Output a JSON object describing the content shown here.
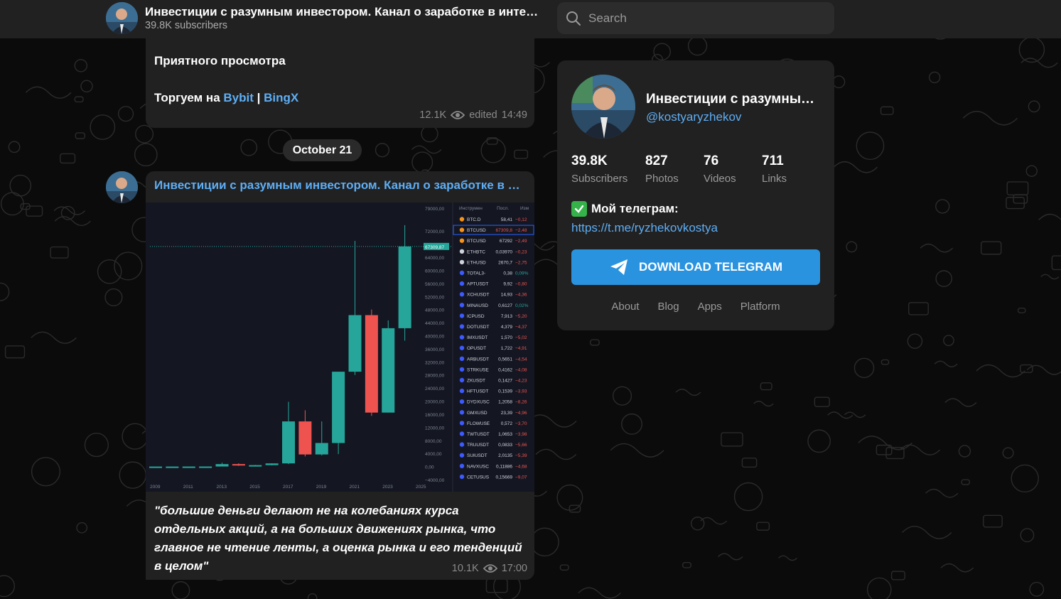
{
  "header": {
    "channel_title": "Инвестиции с разумным инвестором. Канал о заработке в интер…",
    "subscribers": "39.8K subscribers",
    "search_placeholder": "Search"
  },
  "messages": [
    {
      "line1": "Приятного просмотра",
      "line2_prefix": "Торгуем на ",
      "link1": "Bybit",
      "separator": " | ",
      "link2": "BingX",
      "views": "12.1K",
      "edited": "edited",
      "time": "14:49"
    },
    {
      "sender": "Инвестиции с разумным инвестором. Канал о заработке в и…",
      "quote": "\"большие деньги делают не на колебаниях курса отдельных акций, а на больших движениях рынка, что главное не чтение ленты, а оценка рынка и его тенденций в целом\"",
      "views": "10.1K",
      "time": "17:00"
    }
  ],
  "date_separator": "October 21",
  "profile": {
    "name": "Инвестиции с разумны…",
    "handle": "@kostyaryzhekov",
    "stats": [
      {
        "value": "39.8K",
        "label": "Subscribers"
      },
      {
        "value": "827",
        "label": "Photos"
      },
      {
        "value": "76",
        "label": "Videos"
      },
      {
        "value": "711",
        "label": "Links"
      }
    ],
    "telegram_label": "Мой телеграм:",
    "telegram_link": "https://t.me/ryzhekovkostya",
    "download_button": "DOWNLOAD TELEGRAM",
    "footer_links": [
      "About",
      "Blog",
      "Apps",
      "Platform"
    ]
  },
  "chart_data": {
    "type": "candlestick",
    "title": "",
    "price_tag": "67309,87",
    "x": [
      "2009",
      "2010",
      "2011",
      "2012",
      "2013",
      "2014",
      "2015",
      "2016",
      "2017",
      "2018",
      "2019",
      "2020",
      "2021",
      "2022",
      "2023",
      "2024",
      "2025"
    ],
    "x_tick_labels": [
      "2009",
      "2011",
      "2013",
      "2015",
      "2017",
      "2019",
      "2021",
      "2023",
      "2025"
    ],
    "y_tick_labels": [
      "79000,00",
      "72000,00",
      "64000,00",
      "60000,00",
      "56000,00",
      "52000,00",
      "48000,00",
      "44000,00",
      "40000,00",
      "36000,00",
      "32000,00",
      "28000,00",
      "24000,00",
      "20000,00",
      "16000,00",
      "12000,00",
      "8000,00",
      "4000,00",
      "0,00",
      "−4000,00"
    ],
    "candles": [
      {
        "year": "2009",
        "open": 0,
        "high": 0,
        "low": 0,
        "close": 0
      },
      {
        "year": "2010",
        "open": 0,
        "high": 0,
        "low": 0,
        "close": 0
      },
      {
        "year": "2011",
        "open": 0,
        "high": 30,
        "low": 0,
        "close": 5
      },
      {
        "year": "2012",
        "open": 5,
        "high": 14,
        "low": 4,
        "close": 13
      },
      {
        "year": "2013",
        "open": 13,
        "high": 1150,
        "low": 12,
        "close": 750
      },
      {
        "year": "2014",
        "open": 750,
        "high": 1000,
        "low": 200,
        "close": 320
      },
      {
        "year": "2015",
        "open": 320,
        "high": 500,
        "low": 160,
        "close": 430
      },
      {
        "year": "2016",
        "open": 430,
        "high": 980,
        "low": 350,
        "close": 960
      },
      {
        "year": "2017",
        "open": 960,
        "high": 19800,
        "low": 750,
        "close": 13800
      },
      {
        "year": "2018",
        "open": 13800,
        "high": 17200,
        "low": 3100,
        "close": 3700
      },
      {
        "year": "2019",
        "open": 3700,
        "high": 13800,
        "low": 3400,
        "close": 7200
      },
      {
        "year": "2020",
        "open": 7200,
        "high": 29000,
        "low": 3800,
        "close": 29000
      },
      {
        "year": "2021",
        "open": 29000,
        "high": 69000,
        "low": 28000,
        "close": 46300
      },
      {
        "year": "2022",
        "open": 46300,
        "high": 48000,
        "low": 15500,
        "close": 16500
      },
      {
        "year": "2023",
        "open": 16500,
        "high": 44700,
        "low": 16500,
        "close": 42300
      },
      {
        "year": "2024",
        "open": 42300,
        "high": 73800,
        "low": 38500,
        "close": 67300
      }
    ],
    "watchlist_headers": [
      "Инструмен",
      "Посл.",
      "Изм"
    ],
    "watchlist": [
      {
        "symbol": "BTC.D",
        "last": "58,41",
        "change": "−0,12"
      },
      {
        "symbol": "BTCUSD",
        "last": "67309,8",
        "change": "−2,48"
      },
      {
        "symbol": "BTCUSD",
        "last": "67292",
        "change": "−2,49"
      },
      {
        "symbol": "ETHBTC",
        "last": "0,03970",
        "change": "−0,23"
      },
      {
        "symbol": "ETHUSD",
        "last": "2670,7",
        "change": "−2,75"
      },
      {
        "symbol": "TOTAL3-",
        "last": "0,38",
        "change": "0,09%"
      },
      {
        "symbol": "APTUSDT",
        "last": "9,92",
        "change": "−0,80"
      },
      {
        "symbol": "XCHUSDT",
        "last": "14,93",
        "change": "−4,36"
      },
      {
        "symbol": "MINAUSD",
        "last": "0,6127",
        "change": "0,02%"
      },
      {
        "symbol": "ICPUSD",
        "last": "7,913",
        "change": "−5,20"
      },
      {
        "symbol": "DOTUSDT",
        "last": "4,379",
        "change": "−4,37"
      },
      {
        "symbol": "IMXUSDT",
        "last": "1,570",
        "change": "−5,02"
      },
      {
        "symbol": "OPUSDT",
        "last": "1,722",
        "change": "−4,91"
      },
      {
        "symbol": "ARBUSDT",
        "last": "0,5651",
        "change": "−4,54"
      },
      {
        "symbol": "STRKUSE",
        "last": "0,4162",
        "change": "−4,08"
      },
      {
        "symbol": "ZKUSDT",
        "last": "0,1427",
        "change": "−4,23"
      },
      {
        "symbol": "HFTUSDT",
        "last": "0,1539",
        "change": "−3,93"
      },
      {
        "symbol": "DYDXUSC",
        "last": "1,2058",
        "change": "−8,26"
      },
      {
        "symbol": "GMXUSD",
        "last": "23,39",
        "change": "−4,96"
      },
      {
        "symbol": "FLOWUSE",
        "last": "0,572",
        "change": "−3,70"
      },
      {
        "symbol": "TWTUSDT",
        "last": "1,0653",
        "change": "−3,98"
      },
      {
        "symbol": "TRUUSDT",
        "last": "0,0833",
        "change": "−5,66"
      },
      {
        "symbol": "SUIUSDT",
        "last": "2,0135",
        "change": "−5,39"
      },
      {
        "symbol": "NAVXUSC",
        "last": "0,11886",
        "change": "−4,68"
      },
      {
        "symbol": "CETUSUS",
        "last": "0,15669",
        "change": "−9,07"
      }
    ],
    "colors": {
      "up": "#26a69a",
      "down": "#ef5350",
      "bg": "#141722"
    }
  },
  "colors": {
    "accent": "#2a93e0",
    "link": "#5eaef5",
    "panel": "#212121"
  }
}
